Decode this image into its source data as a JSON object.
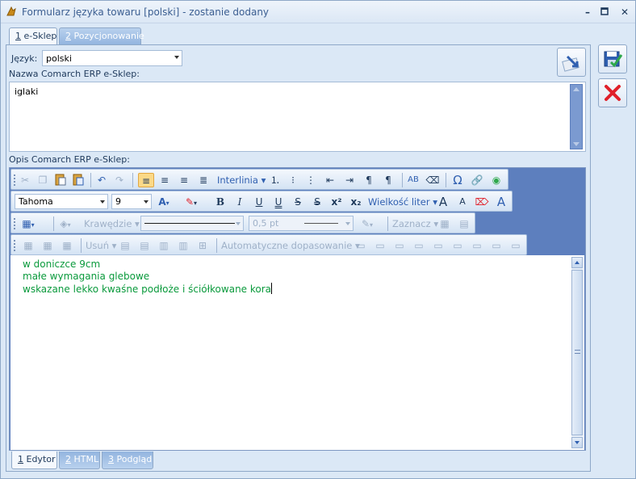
{
  "window": {
    "title": "Formularz języka towaru [polski] - zostanie dodany",
    "controls": [
      "minimize",
      "maximize",
      "close"
    ]
  },
  "tabs_top": [
    {
      "num": "1",
      "label": " e-Sklep",
      "active": true
    },
    {
      "num": "2",
      "label": " Pozycjonowanie",
      "active": false
    }
  ],
  "form": {
    "language_label": "Język:",
    "language_value": "polski",
    "name_label": "Nazwa Comarch ERP e-Sklep:",
    "name_value": "iglaki",
    "description_label": "Opis Comarch ERP e-Sklep:"
  },
  "toolbar": {
    "line_spacing": "Interlinia",
    "font_name": "Tahoma",
    "font_size": "9",
    "letter_case": "Wielkość liter",
    "borders": "Krawędzie",
    "border_width": "0,5 pt",
    "select": "Zaznacz",
    "delete": "Usuń",
    "autofit": "Automatyczne dopasowanie"
  },
  "document": {
    "lines": [
      "w doniczce 9cm",
      "małe wymagania glebowe",
      "wskazane lekko kwaśne podłoże i ściółkowane kora"
    ],
    "text_color": "#0a9a3c"
  },
  "tabs_bottom": [
    {
      "num": "1",
      "label": " Edytor",
      "active": true
    },
    {
      "num": "2",
      "label": " HTML",
      "active": false
    },
    {
      "num": "3",
      "label": " Podgląd",
      "active": false
    }
  ],
  "icons": {
    "save": "save-icon",
    "cancel": "cancel-icon",
    "translate": "translate-icon"
  }
}
